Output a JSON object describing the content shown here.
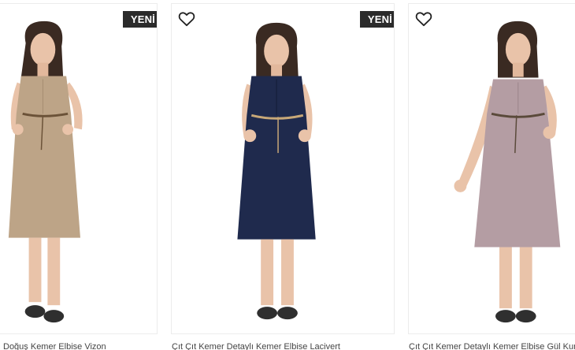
{
  "products": [
    {
      "badge": "YENİ",
      "title": "Doğuş Kemer Elbise Vizon",
      "dress_color": "#bda487",
      "has_fav": false
    },
    {
      "badge": "YENİ",
      "title": "Çıt Çıt Kemer Detaylı Kemer Elbise Lacivert",
      "dress_color": "#1f2a4d",
      "has_fav": true
    },
    {
      "badge": "",
      "title": "Çıt Çıt Kemer Detaylı Kemer Elbise Gül Kurusu",
      "dress_color": "#b49da3",
      "has_fav": true
    }
  ],
  "colors": {
    "badge_bg": "#2b2b2b",
    "badge_text": "#ffffff",
    "card_border": "#ececec",
    "skin": "#e9c3a9",
    "hair": "#3a2a22"
  }
}
